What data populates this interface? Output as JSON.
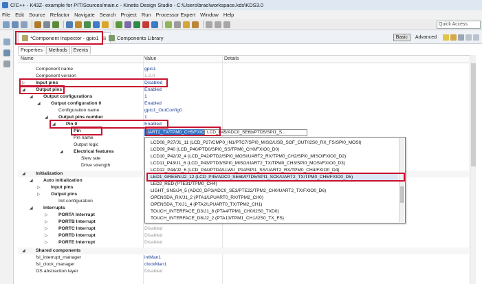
{
  "window": {
    "title": "C/C++ - K43Z- example for PIT/Sources/main.c - Kinetis Design Studio - C:\\Users\\brao\\workspace.kds\\KDS3.0"
  },
  "menu": [
    "File",
    "Edit",
    "Source",
    "Refactor",
    "Navigate",
    "Search",
    "Project",
    "Run",
    "Processor Expert",
    "Window",
    "Help"
  ],
  "quick_access": "Quick Access",
  "tabs": {
    "inspector": "*Component Inspector - gpio1",
    "library": "Components Library",
    "close_glyph": "⊠"
  },
  "mode": {
    "basic": "Basic",
    "advanced": "Advanced"
  },
  "subtabs": [
    "Properties",
    "Methods",
    "Events"
  ],
  "columns": {
    "name": "Name",
    "value": "Value",
    "details": "Details"
  },
  "rows": [
    {
      "name": "Component name",
      "value": "gpio1"
    },
    {
      "name": "Component version",
      "value": "1.2.0"
    },
    {
      "name": "Input pins",
      "value": "Disabled"
    },
    {
      "name": "Output pins",
      "value": "Enabled"
    },
    {
      "name": "Output configurations",
      "value": "1"
    },
    {
      "name": "Output configuration 0",
      "value": "Enabled"
    },
    {
      "name": "Configuration name",
      "value": "gpio1_OutConfig0"
    },
    {
      "name": "Output pins number",
      "value": "1"
    },
    {
      "name": "Pin 0",
      "value": "Enabled"
    },
    {
      "name": "Pin",
      "value": "UART2_TX/TPM0_CH5/FXIO0_D5"
    },
    {
      "name": "Pin name",
      "value": ""
    },
    {
      "name": "Output logic",
      "value": ""
    },
    {
      "name": "Electrical features",
      "value": ""
    },
    {
      "name": "Slew rate",
      "value": ""
    },
    {
      "name": "Drive strength",
      "value": ""
    },
    {
      "name": "Initialization",
      "value": ""
    },
    {
      "name": "Auto initialization",
      "value": ""
    },
    {
      "name": "Input pins",
      "value": ""
    },
    {
      "name": "Output pins",
      "value": ""
    },
    {
      "name": "Init configuration",
      "value": ""
    },
    {
      "name": "Interrupts",
      "value": ""
    },
    {
      "name": "PORTA Interrupt",
      "value": ""
    },
    {
      "name": "PORTB Interrupt",
      "value": "Disabled"
    },
    {
      "name": "PORTC Interrupt",
      "value": "Disabled"
    },
    {
      "name": "PORTD Interrupt",
      "value": "Disabled"
    },
    {
      "name": "PORTE Interrupt",
      "value": "Disabled"
    },
    {
      "name": "Shared components",
      "value": ""
    },
    {
      "name": "fsl_interrupt_manager",
      "value": "intMan1"
    },
    {
      "name": "fsl_clock_manager",
      "value": "clockMan1"
    },
    {
      "name": "OS abstraction layer",
      "value": "Disabled"
    }
  ],
  "pin_combo": {
    "selected": "UART2_TX/TPM0_CH5/FXIO0_D5",
    "details": "LCD_P45/ADC0_SE6b/PTD5/SPI1_S..."
  },
  "dropdown_options": [
    "LCD08_P27/J1_11 (LCD_P27/CMP0_IN1/PTC7/SPI0_MISO/USB_SOF_OUT/I2S0_RX_FS/SPI0_MOSI)",
    "LCD09_P40 (LCD_P40/PTD0/SPI0_SS/TPM0_CH0/FXIO0_D0)",
    "LCD10_P42/J2_4 (LCD_P42/PTD2/SPI0_MOSI/UART2_RX/TPM0_CH2/SPI0_MISO/FXIO0_D2)",
    "LCD11_P43/J1_6 (LCD_P43/PTD3/SPI0_MISO/UART2_TX/TPM0_CH3/SPI0_MOSI/FXIO0_D3)",
    "LCD12_P44/J2_6 (LCD_P44/PTD4/LLWU_P14/SPI1_SS/UART2_RX/TPM0_CH4/FXIO0_D4)",
    "LED1_GREEN/J2_12 (LCD_P45/ADC0_SE6b/PTD5/SPI1_SCK/UART2_TX/TPM0_CH5/FXIO0_D5)",
    "LED2_RED (PTE31/TPM0_CH4)",
    "LIGHT_SNS/J4_5 (ADC0_DP3/ADC0_SE3/PTE22/TPM2_CH0/UART2_TX/FXIO0_D6)",
    "OPENSDA_RX/J1_2 (PTA1/LPUART0_RX/TPM2_CH0)",
    "OPENSDA_TX/J1_4 (PTA2/LPUART0_TX/TPM2_CH1)",
    "TOUCH_INTERFACE_D3/J1_8 (PTA4/TPM1_CH0/I2S0_TXD0)",
    "TOUCH_INTERFACE_D8/J2_2 (PTA13/TPM1_CH1/I2S0_TX_FS)"
  ],
  "colors": {
    "highlight_border": "#c8102e",
    "selection": "#2f6fc4",
    "value_text": "#1c3f97"
  }
}
